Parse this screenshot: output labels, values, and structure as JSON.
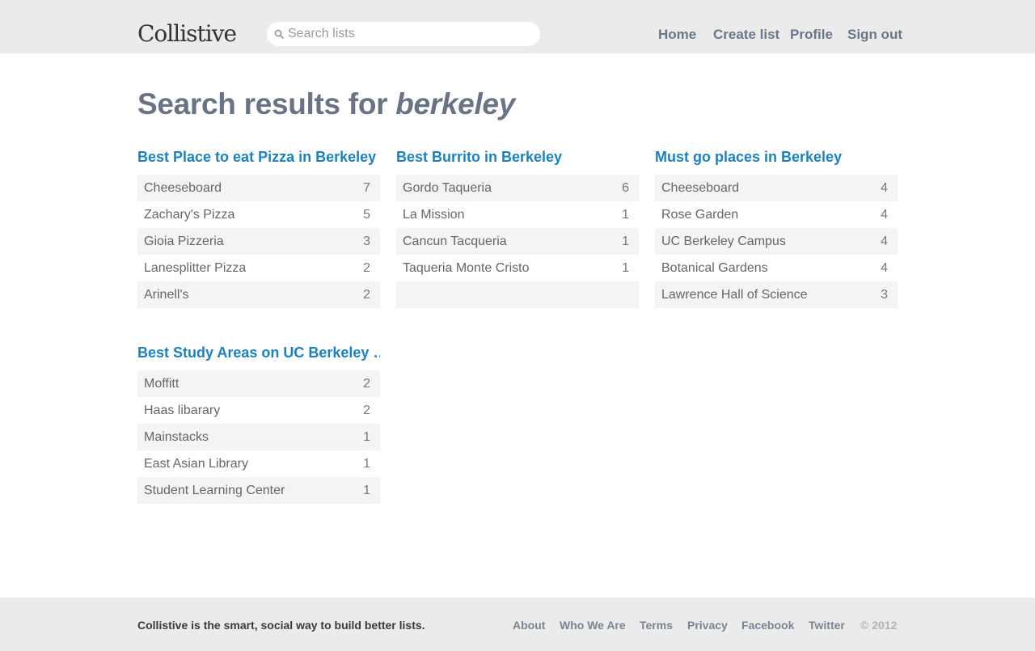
{
  "header": {
    "logo": "Collistive",
    "search_placeholder": "Search lists",
    "nav": [
      "Home",
      "Create list",
      "Profile",
      "Sign out"
    ]
  },
  "page": {
    "title_prefix": "Search results for ",
    "query": "berkeley"
  },
  "lists": [
    {
      "title": "Best Place to eat Pizza in Berkeley",
      "items": [
        {
          "name": "Cheeseboard",
          "count": "7"
        },
        {
          "name": "Zachary's Pizza",
          "count": "5"
        },
        {
          "name": "Gioia Pizzeria",
          "count": "3"
        },
        {
          "name": "Lanesplitter Pizza",
          "count": "2"
        },
        {
          "name": "Arinell's",
          "count": "2"
        }
      ]
    },
    {
      "title": "Best Burrito in Berkeley",
      "items": [
        {
          "name": "Gordo Taqueria",
          "count": "6"
        },
        {
          "name": "La Mission",
          "count": "1"
        },
        {
          "name": "Cancun Tacqueria",
          "count": "1"
        },
        {
          "name": "Taqueria Monte Cristo",
          "count": "1"
        },
        {
          "name": "",
          "count": ""
        }
      ]
    },
    {
      "title": "Must go places in Berkeley",
      "items": [
        {
          "name": "Cheeseboard",
          "count": "4"
        },
        {
          "name": "Rose Garden",
          "count": "4"
        },
        {
          "name": "UC Berkeley Campus",
          "count": "4"
        },
        {
          "name": "Botanical Gardens",
          "count": "4"
        },
        {
          "name": "Lawrence Hall of Science",
          "count": "3"
        }
      ]
    },
    {
      "title": "Best Study Areas on UC Berkeley …",
      "items": [
        {
          "name": "Moffitt",
          "count": "2"
        },
        {
          "name": "Haas libarary",
          "count": "2"
        },
        {
          "name": "Mainstacks",
          "count": "1"
        },
        {
          "name": "East Asian Library",
          "count": "1"
        },
        {
          "name": "Student Learning Center",
          "count": "1"
        }
      ]
    }
  ],
  "footer": {
    "tagline": "Collistive is the smart, social way to build better lists.",
    "links": [
      "About",
      "Who We Are",
      "Terms",
      "Privacy",
      "Facebook",
      "Twitter"
    ],
    "copyright": "© 2012"
  }
}
